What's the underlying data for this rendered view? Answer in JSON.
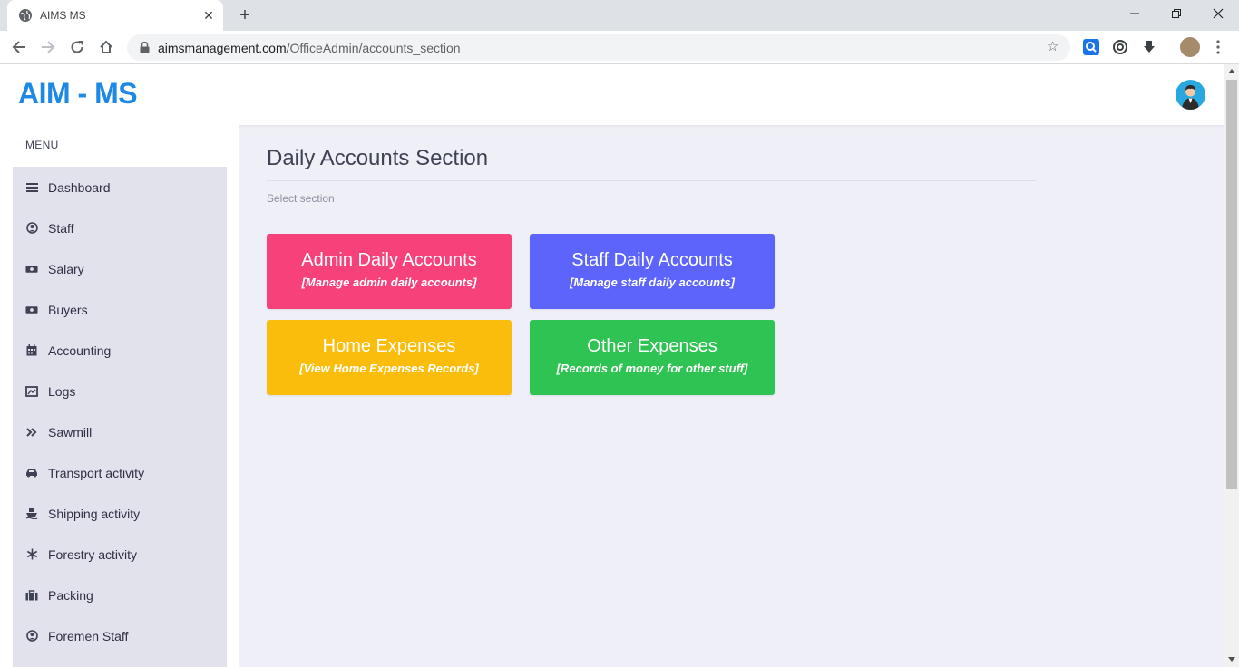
{
  "browser": {
    "tab_title": "AIMS MS",
    "tab_close": "✕",
    "new_tab": "+",
    "url_domain": "aimsmanagement.com",
    "url_path": "/OfficeAdmin/accounts_section"
  },
  "app": {
    "logo": "AIM - MS"
  },
  "sidebar": {
    "heading": "MENU",
    "items": [
      {
        "label": "Dashboard",
        "icon": "bars-icon"
      },
      {
        "label": "Staff",
        "icon": "user-circle-icon"
      },
      {
        "label": "Salary",
        "icon": "money-icon"
      },
      {
        "label": "Buyers",
        "icon": "money-icon"
      },
      {
        "label": "Accounting",
        "icon": "calendar-icon"
      },
      {
        "label": "Logs",
        "icon": "image-icon"
      },
      {
        "label": "Sawmill",
        "icon": "double-chevron-icon"
      },
      {
        "label": "Transport activity",
        "icon": "car-icon"
      },
      {
        "label": "Shipping activity",
        "icon": "ship-icon"
      },
      {
        "label": "Forestry activity",
        "icon": "snowflake-icon"
      },
      {
        "label": "Packing",
        "icon": "briefcase-icon"
      },
      {
        "label": "Foremen Staff",
        "icon": "user-circle-icon"
      }
    ]
  },
  "main": {
    "title": "Daily Accounts Section",
    "subtitle": "Select section",
    "cards": [
      {
        "title": "Admin Daily Accounts",
        "subtitle": "[Manage admin daily accounts]",
        "color": "#f6417a"
      },
      {
        "title": "Staff Daily Accounts",
        "subtitle": "[Manage staff daily accounts]",
        "color": "#5c64fb"
      },
      {
        "title": "Home Expenses",
        "subtitle": "[View Home Expenses Records]",
        "color": "#fbbd0b"
      },
      {
        "title": "Other Expenses",
        "subtitle": "[Records of money for other stuff]",
        "color": "#2ec352"
      }
    ]
  },
  "colors": {
    "accent": "#1e88e5",
    "background": "#eff0f7",
    "sidebar_list": "#e1e2ec"
  }
}
